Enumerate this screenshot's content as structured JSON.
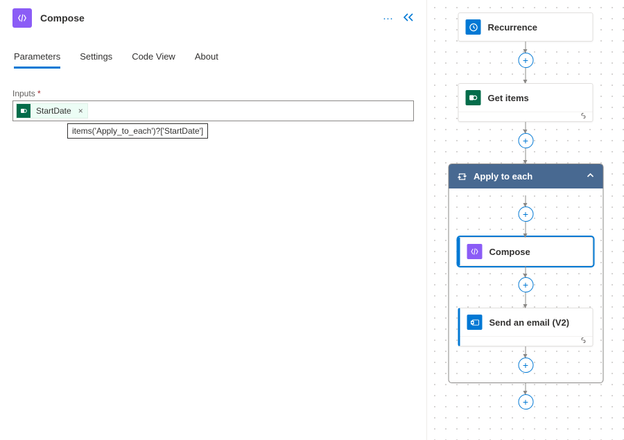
{
  "panel": {
    "title": "Compose",
    "tabs": [
      "Parameters",
      "Settings",
      "Code View",
      "About"
    ],
    "active_tab": 0,
    "inputs_label": "Inputs",
    "token_label": "StartDate",
    "tooltip": "items('Apply_to_each')?['StartDate']"
  },
  "flow": {
    "nodes": [
      {
        "id": "recurrence",
        "label": "Recurrence",
        "iconClass": "recurrence-icon",
        "footer": false
      },
      {
        "id": "getitems",
        "label": "Get items",
        "iconClass": "sharepoint-icon",
        "footer": true
      }
    ],
    "scope": {
      "label": "Apply to each",
      "children": [
        {
          "id": "compose",
          "label": "Compose",
          "iconClass": "compose-icon",
          "selected": true,
          "footer": false
        },
        {
          "id": "sendemail",
          "label": "Send an email (V2)",
          "iconClass": "outlook-icon",
          "selected": false,
          "footer": true
        }
      ]
    }
  }
}
